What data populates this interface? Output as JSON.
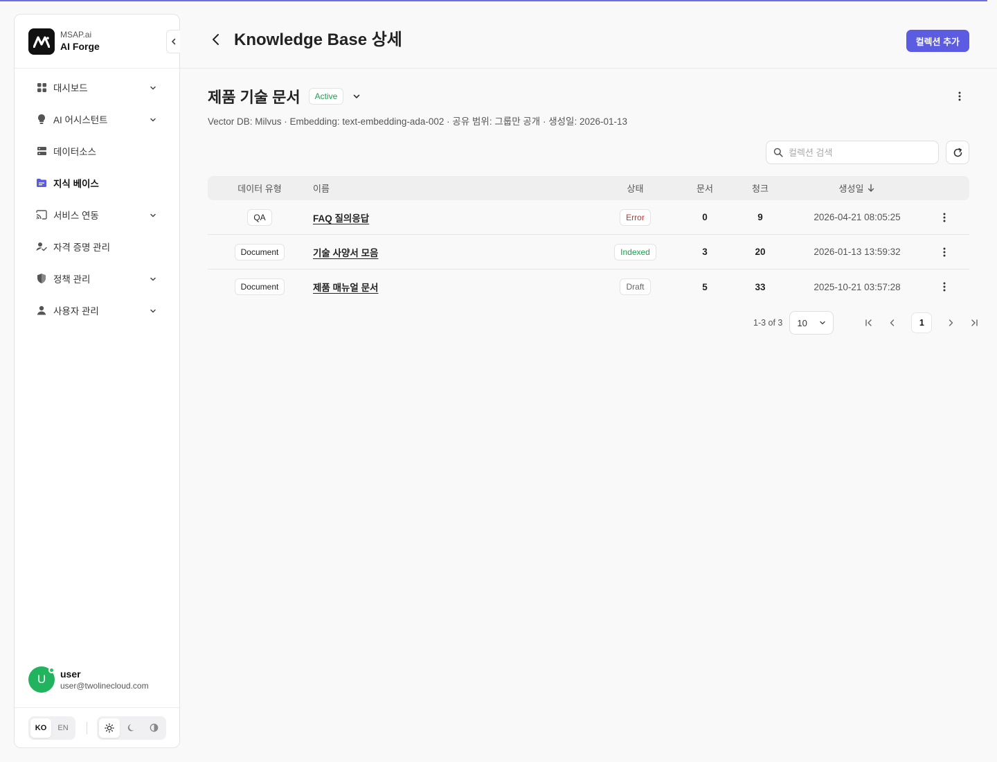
{
  "brand": {
    "sub": "MSAP.ai",
    "name": "AI Forge"
  },
  "sidebar": {
    "items": [
      {
        "label": "대시보드",
        "icon": "dashboard-icon",
        "chevron": true,
        "active": false
      },
      {
        "label": "AI 어시스턴트",
        "icon": "lightbulb-icon",
        "chevron": true,
        "active": false
      },
      {
        "label": "데이터소스",
        "icon": "server-icon",
        "chevron": false,
        "active": false
      },
      {
        "label": "지식 베이스",
        "icon": "folder-icon",
        "chevron": false,
        "active": true
      },
      {
        "label": "서비스 연동",
        "icon": "cast-icon",
        "chevron": true,
        "active": false
      },
      {
        "label": "자격 증명 관리",
        "icon": "user-check-icon",
        "chevron": false,
        "active": false
      },
      {
        "label": "정책 관리",
        "icon": "shield-icon",
        "chevron": true,
        "active": false
      },
      {
        "label": "사용자 관리",
        "icon": "person-icon",
        "chevron": true,
        "active": false
      }
    ]
  },
  "user": {
    "initial": "U",
    "name": "user",
    "email": "user@twolinecloud.com"
  },
  "footer": {
    "lang_ko": "KO",
    "lang_en": "EN",
    "active_lang": "KO",
    "active_theme": "light"
  },
  "header": {
    "title": "Knowledge Base 상세",
    "add_button": "컬렉션 추가"
  },
  "kb": {
    "title": "제품 기술 문서",
    "status": "Active",
    "meta": "Vector DB: Milvus · Embedding: text-embedding-ada-002 · 공유 범위: 그룹만 공개 · 생성일: 2026-01-13"
  },
  "search": {
    "placeholder": "컬렉션 검색",
    "value": ""
  },
  "table": {
    "headers": {
      "type": "데이터 유형",
      "name": "이름",
      "status": "상태",
      "docs": "문서",
      "chunks": "청크",
      "date": "생성일"
    },
    "rows": [
      {
        "type": "QA",
        "name": "FAQ 질의응답",
        "status": "Error",
        "docs": "0",
        "chunks": "9",
        "date": "2026-04-21 08:05:25"
      },
      {
        "type": "Document",
        "name": "기술 사양서 모음",
        "status": "Indexed",
        "docs": "3",
        "chunks": "20",
        "date": "2026-01-13 13:59:32"
      },
      {
        "type": "Document",
        "name": "제품 매뉴얼 문서",
        "status": "Draft",
        "docs": "5",
        "chunks": "33",
        "date": "2025-10-21 03:57:28"
      }
    ]
  },
  "pagination": {
    "info": "1-3 of 3",
    "page_size": "10",
    "current_page": "1"
  },
  "colors": {
    "accent": "#5b5ce2",
    "success": "#16a34a",
    "error": "#dc2626",
    "avatar": "#22b35e"
  }
}
